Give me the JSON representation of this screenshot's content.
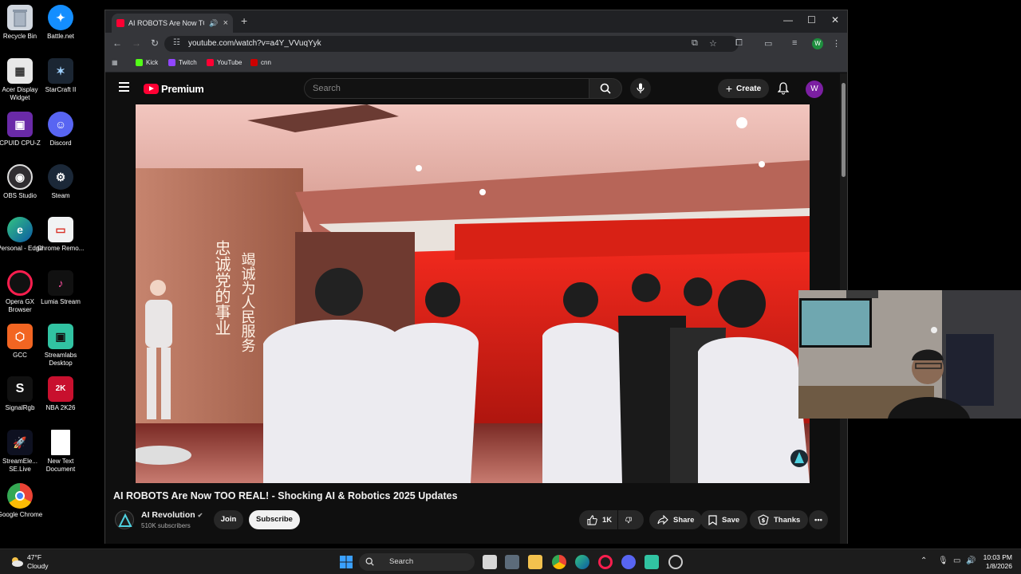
{
  "desktop": {
    "icons": [
      {
        "label": "Recycle Bin",
        "icon": "recycle-bin-icon"
      },
      {
        "label": "Battle.net",
        "icon": "battlenet-icon"
      },
      {
        "label": "Acer Display Widget",
        "icon": "acer-icon"
      },
      {
        "label": "StarCraft II",
        "icon": "starcraft-icon"
      },
      {
        "label": "CPUID CPU-Z",
        "icon": "cpuz-icon"
      },
      {
        "label": "Discord",
        "icon": "discord-icon"
      },
      {
        "label": "OBS Studio",
        "icon": "obs-icon"
      },
      {
        "label": "Steam",
        "icon": "steam-icon"
      },
      {
        "label": "Personal - Edge",
        "icon": "edge-icon"
      },
      {
        "label": "Chrome Remo...",
        "icon": "chrome-remote-icon"
      },
      {
        "label": "Opera GX Browser",
        "icon": "opera-gx-icon"
      },
      {
        "label": "Lumia Stream",
        "icon": "lumia-icon"
      },
      {
        "label": "GCC",
        "icon": "gcc-icon"
      },
      {
        "label": "Streamlabs Desktop",
        "icon": "streamlabs-icon"
      },
      {
        "label": "SignalRgb",
        "icon": "signalrgb-icon"
      },
      {
        "label": "NBA 2K26",
        "icon": "nba2k-icon"
      },
      {
        "label": "StreamEle... SE.Live",
        "icon": "streamelements-icon"
      },
      {
        "label": "New Text Document",
        "icon": "text-document-icon"
      },
      {
        "label": "Google Chrome",
        "icon": "chrome-icon"
      }
    ]
  },
  "browser": {
    "tab_title": "AI ROBOTS Are Now TOO REAL!",
    "url": "youtube.com/watch?v=a4Y_VVuqYyk",
    "bookmarks": [
      {
        "label": "Kick",
        "color": "#53fc18"
      },
      {
        "label": "Twitch",
        "color": "#9146ff"
      },
      {
        "label": "YouTube",
        "color": "#ff0033"
      },
      {
        "label": "cnn",
        "color": "#cc0000"
      }
    ],
    "profile_initial": "W"
  },
  "youtube": {
    "logo_text": "Premium",
    "search_placeholder": "Search",
    "create_label": "Create",
    "avatar_initial": "W",
    "video_title": "AI ROBOTS Are Now TOO REAL! - Shocking AI & Robotics 2025 Updates",
    "channel_name": "AI Revolution",
    "subscribers": "510K subscribers",
    "join_label": "Join",
    "subscribe_label": "Subscribe",
    "like_count": "1K",
    "share_label": "Share",
    "save_label": "Save",
    "thanks_label": "Thanks",
    "video_sign_left": "忠诚党的事业",
    "video_sign_right": "竭诚为人民服务"
  },
  "taskbar": {
    "temperature": "47°F",
    "weather": "Cloudy",
    "search_label": "Search",
    "time": "10:03 PM",
    "date": "1/8/2026"
  },
  "colors": {
    "youtube_red": "#ff0033",
    "background": "#0f0f0f",
    "avatar_purple": "#7b1fa2"
  }
}
